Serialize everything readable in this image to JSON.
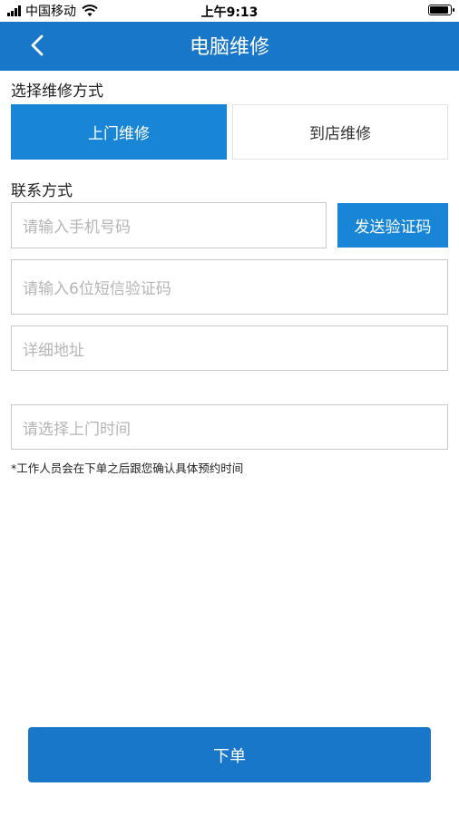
{
  "status_bar": {
    "carrier": "中国移动",
    "time": "上午9:13",
    "icons": [
      "signal-icon",
      "wifi-icon",
      "battery-icon"
    ]
  },
  "nav": {
    "title": "电脑维修",
    "back_icon": "chevron-left-icon"
  },
  "repair_method": {
    "label": "选择维修方式",
    "options": [
      {
        "label": "上门维修",
        "selected": true
      },
      {
        "label": "到店维修",
        "selected": false
      }
    ]
  },
  "contact": {
    "label": "联系方式",
    "phone_placeholder": "请输入手机号码",
    "send_code_label": "发送验证码",
    "code_placeholder": "请输入6位短信验证码",
    "address_placeholder": "详细地址",
    "time_placeholder": "请选择上门时间"
  },
  "note": "*工作人员会在下单之后跟您确认具体预约时间",
  "submit_label": "下单",
  "colors": {
    "header": "#1877c9",
    "accent": "#1885d6",
    "background": "#ffffff"
  }
}
